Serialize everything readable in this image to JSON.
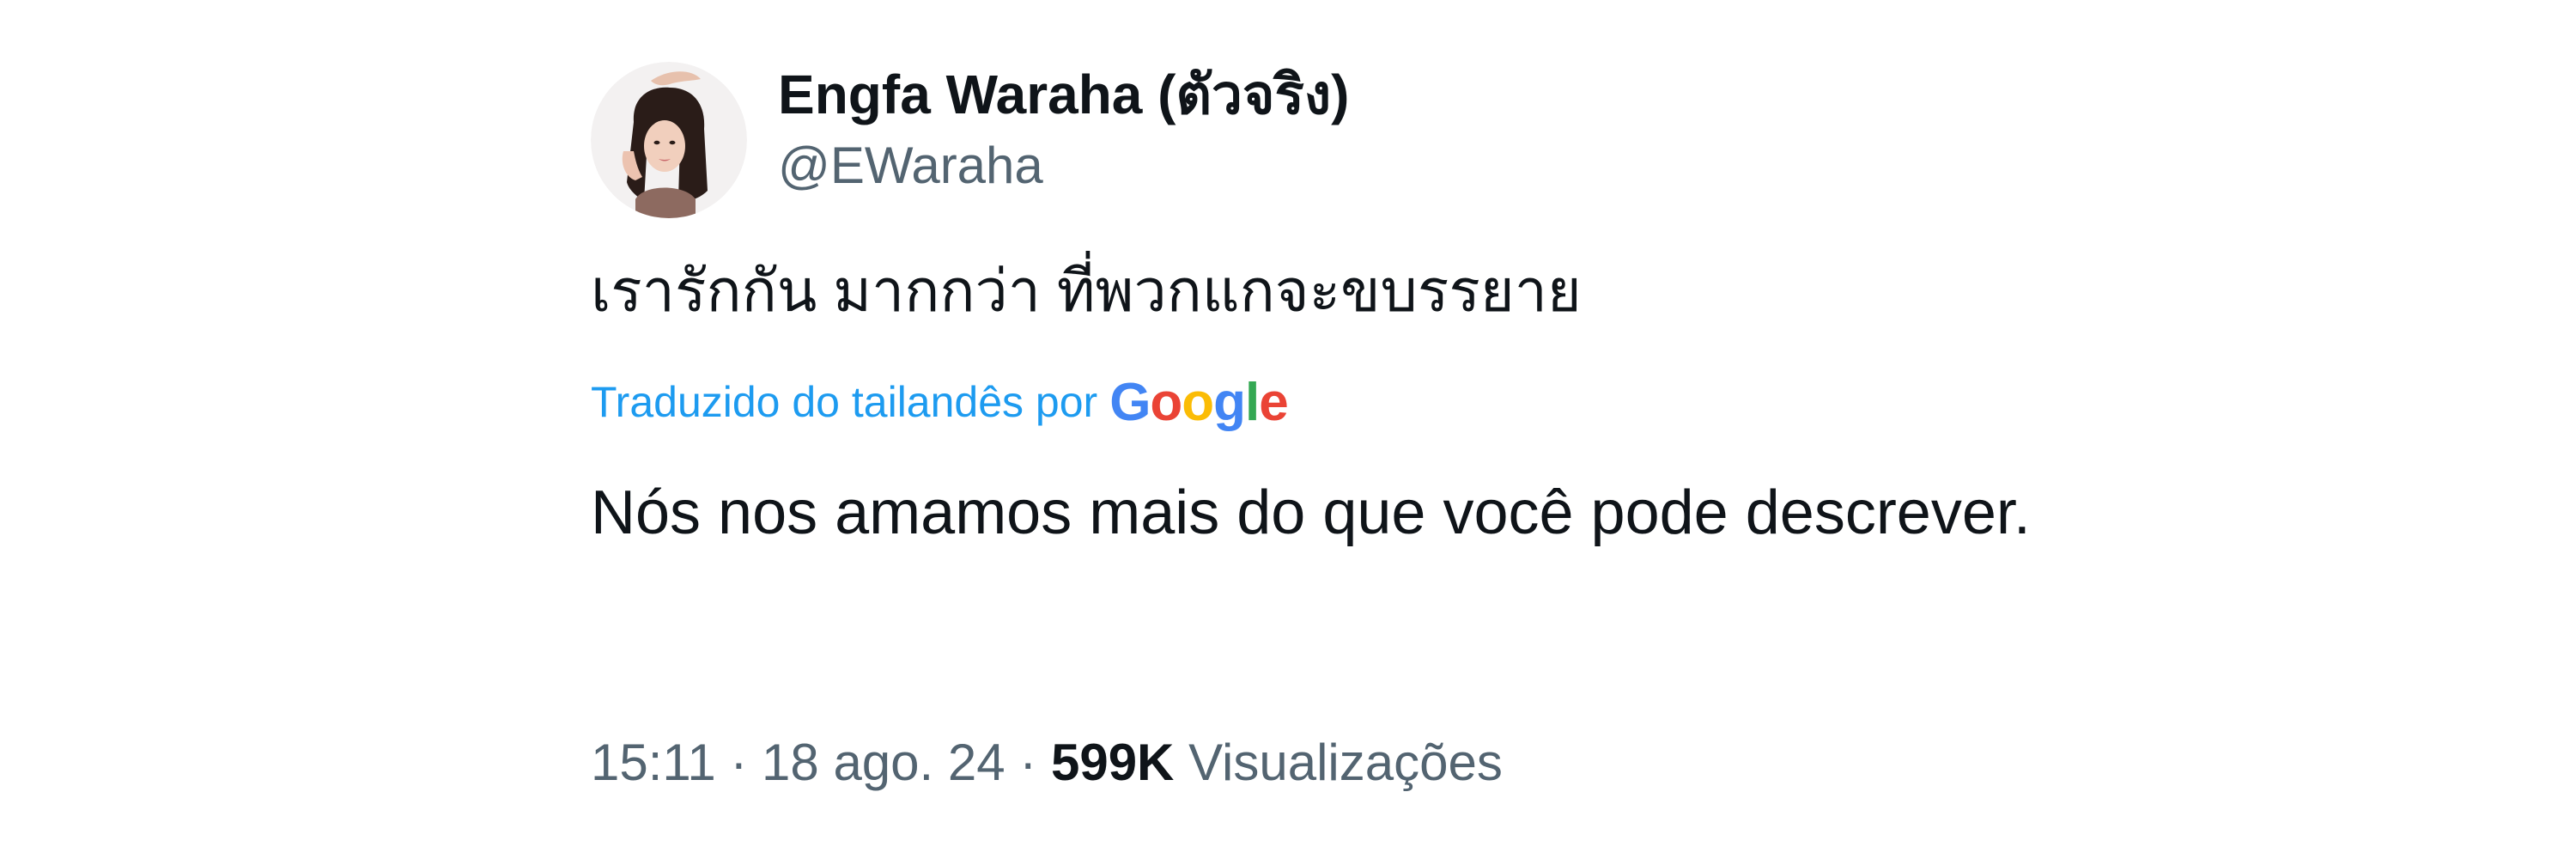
{
  "tweet": {
    "author": {
      "display_name": "Engfa Waraha (ตัวจริง)",
      "handle": "@EWaraha"
    },
    "original_text": "เรารักกัน มากกว่า ที่พวกแกจะขบรรยาย",
    "translation": {
      "label": "Traduzido do tailandês por",
      "provider_letters": [
        "G",
        "o",
        "o",
        "g",
        "l",
        "e"
      ],
      "provider_colors": [
        "#4285F4",
        "#EA4335",
        "#FBBC05",
        "#4285F4",
        "#34A853",
        "#EA4335"
      ],
      "text": "Nós nos amamos mais do que você pode descrever."
    },
    "meta": {
      "time": "15:11",
      "separator": "·",
      "date": "18 ago. 24",
      "views_count": "599K",
      "views_label": "Visualizações"
    }
  },
  "colors": {
    "text_primary": "#0f1419",
    "text_secondary": "#536471",
    "link": "#1d9bf0"
  }
}
